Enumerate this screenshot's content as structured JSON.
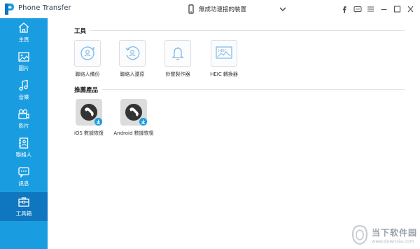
{
  "app": {
    "title": "Phone Transfer"
  },
  "header": {
    "device_label": "無成功連接的裝置",
    "window_controls": [
      "facebook-icon",
      "chat-icon",
      "menu-icon",
      "minimize-icon",
      "maximize-icon",
      "close-icon"
    ]
  },
  "sidebar": {
    "active_index": 6,
    "items": [
      {
        "label": "主頁",
        "icon": "home-icon"
      },
      {
        "label": "圖片",
        "icon": "picture-icon"
      },
      {
        "label": "音樂",
        "icon": "music-icon"
      },
      {
        "label": "影片",
        "icon": "video-icon"
      },
      {
        "label": "聯絡人",
        "icon": "contacts-icon"
      },
      {
        "label": "訊息",
        "icon": "message-icon"
      },
      {
        "label": "工具箱",
        "icon": "toolbox-icon"
      }
    ]
  },
  "main": {
    "tools_section_title": "工具",
    "tools": [
      {
        "label": "聯絡人備份",
        "icon": "contact-backup-icon"
      },
      {
        "label": "聯絡人還原",
        "icon": "contact-restore-icon"
      },
      {
        "label": "鈴聲製作器",
        "icon": "bell-icon"
      },
      {
        "label": "HEIC 轉換器",
        "icon": "heic-converter-icon"
      }
    ],
    "products_section_title": "推薦產品",
    "products": [
      {
        "label": "iOS 數據恢復",
        "icon": "ios-recovery-icon"
      },
      {
        "label": "Android 數據恢復",
        "icon": "android-recovery-icon"
      }
    ]
  },
  "watermark": {
    "main": "当下软件园",
    "sub": "www.downxia.com"
  },
  "colors": {
    "sidebar": "#1a9de0",
    "sidebar_active": "#0f76c0",
    "tool_icon": "#7cb8e6",
    "badge": "#1a9de0"
  }
}
